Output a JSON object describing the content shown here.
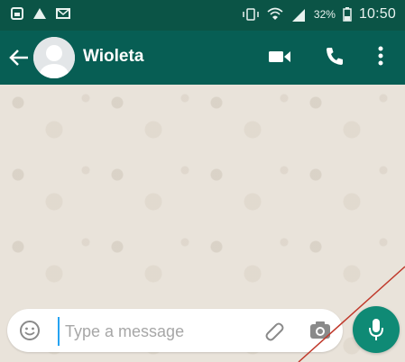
{
  "status_bar": {
    "battery": "32%",
    "time": "10:50"
  },
  "header": {
    "contact_name": "Wioleta"
  },
  "composer": {
    "placeholder": "Type a message"
  },
  "icons": {
    "back": "back-arrow-icon",
    "video": "video-call-icon",
    "phone": "voice-call-icon",
    "menu": "overflow-menu-icon",
    "emoji": "emoji-icon",
    "attach": "paperclip-icon",
    "camera": "camera-icon",
    "mic": "microphone-icon"
  },
  "colors": {
    "status_bar": "#0b5446",
    "app_bar": "#075e54",
    "chat_background": "#e9e3da",
    "mic_button": "#0f8a75",
    "cursor": "#25a3f2",
    "annotation_line": "#c0392b"
  }
}
